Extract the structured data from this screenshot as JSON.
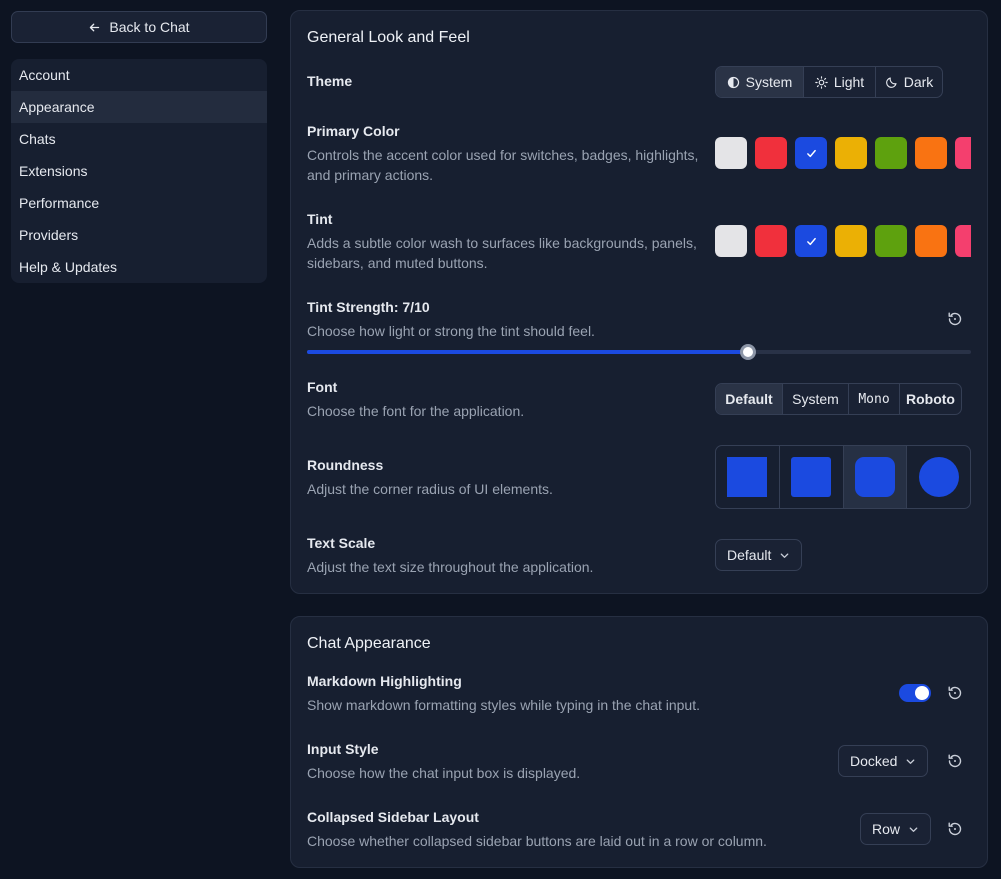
{
  "sidebar": {
    "back_label": "Back to Chat",
    "items": [
      {
        "label": "Account"
      },
      {
        "label": "Appearance",
        "active": true
      },
      {
        "label": "Chats"
      },
      {
        "label": "Extensions"
      },
      {
        "label": "Performance"
      },
      {
        "label": "Providers"
      },
      {
        "label": "Help & Updates"
      }
    ]
  },
  "general": {
    "title": "General Look and Feel",
    "theme": {
      "label": "Theme",
      "options": [
        "System",
        "Light",
        "Dark"
      ],
      "selected": "System"
    },
    "primary_color": {
      "label": "Primary Color",
      "description": "Controls the accent color used for switches, badges, highlights, and primary actions.",
      "swatches": [
        "#e4e4e7",
        "#f0303c",
        "#1b4ae0",
        "#ebb005",
        "#5ea10e",
        "#f97312",
        "#f43f6e"
      ],
      "selected_index": 2
    },
    "tint": {
      "label": "Tint",
      "description": "Adds a subtle color wash to surfaces like backgrounds, panels, sidebars, and muted buttons.",
      "swatches": [
        "#e4e4e7",
        "#f0303c",
        "#1b4ae0",
        "#ebb005",
        "#5ea10e",
        "#f97312",
        "#f43f6e"
      ],
      "selected_index": 2
    },
    "tint_strength": {
      "label": "Tint Strength: 7/10",
      "description": "Choose how light or strong the tint should feel.",
      "value": 7,
      "max": 10
    },
    "font": {
      "label": "Font",
      "description": "Choose the font for the application.",
      "options": [
        "Default",
        "System",
        "Mono",
        "Roboto"
      ],
      "selected": "Default"
    },
    "roundness": {
      "label": "Roundness",
      "description": "Adjust the corner radius of UI elements.",
      "options": [
        "none",
        "small",
        "medium",
        "full"
      ],
      "selected_index": 2
    },
    "text_scale": {
      "label": "Text Scale",
      "description": "Adjust the text size throughout the application.",
      "value": "Default"
    }
  },
  "chat": {
    "title": "Chat Appearance",
    "markdown": {
      "label": "Markdown Highlighting",
      "description": "Show markdown formatting styles while typing in the chat input.",
      "enabled": true
    },
    "input_style": {
      "label": "Input Style",
      "description": "Choose how the chat input box is displayed.",
      "value": "Docked"
    },
    "collapsed_sidebar": {
      "label": "Collapsed Sidebar Layout",
      "description": "Choose whether collapsed sidebar buttons are laid out in a row or column.",
      "value": "Row"
    }
  },
  "icons": {
    "back": "arrow-left-icon",
    "system": "contrast-icon",
    "light": "sun-icon",
    "dark": "moon-icon",
    "check": "check-icon",
    "reset": "reset-icon",
    "chevron": "chevron-down-icon"
  },
  "colors": {
    "accent": "#1b4ae0",
    "background": "#0d1422",
    "card": "#171f30"
  }
}
